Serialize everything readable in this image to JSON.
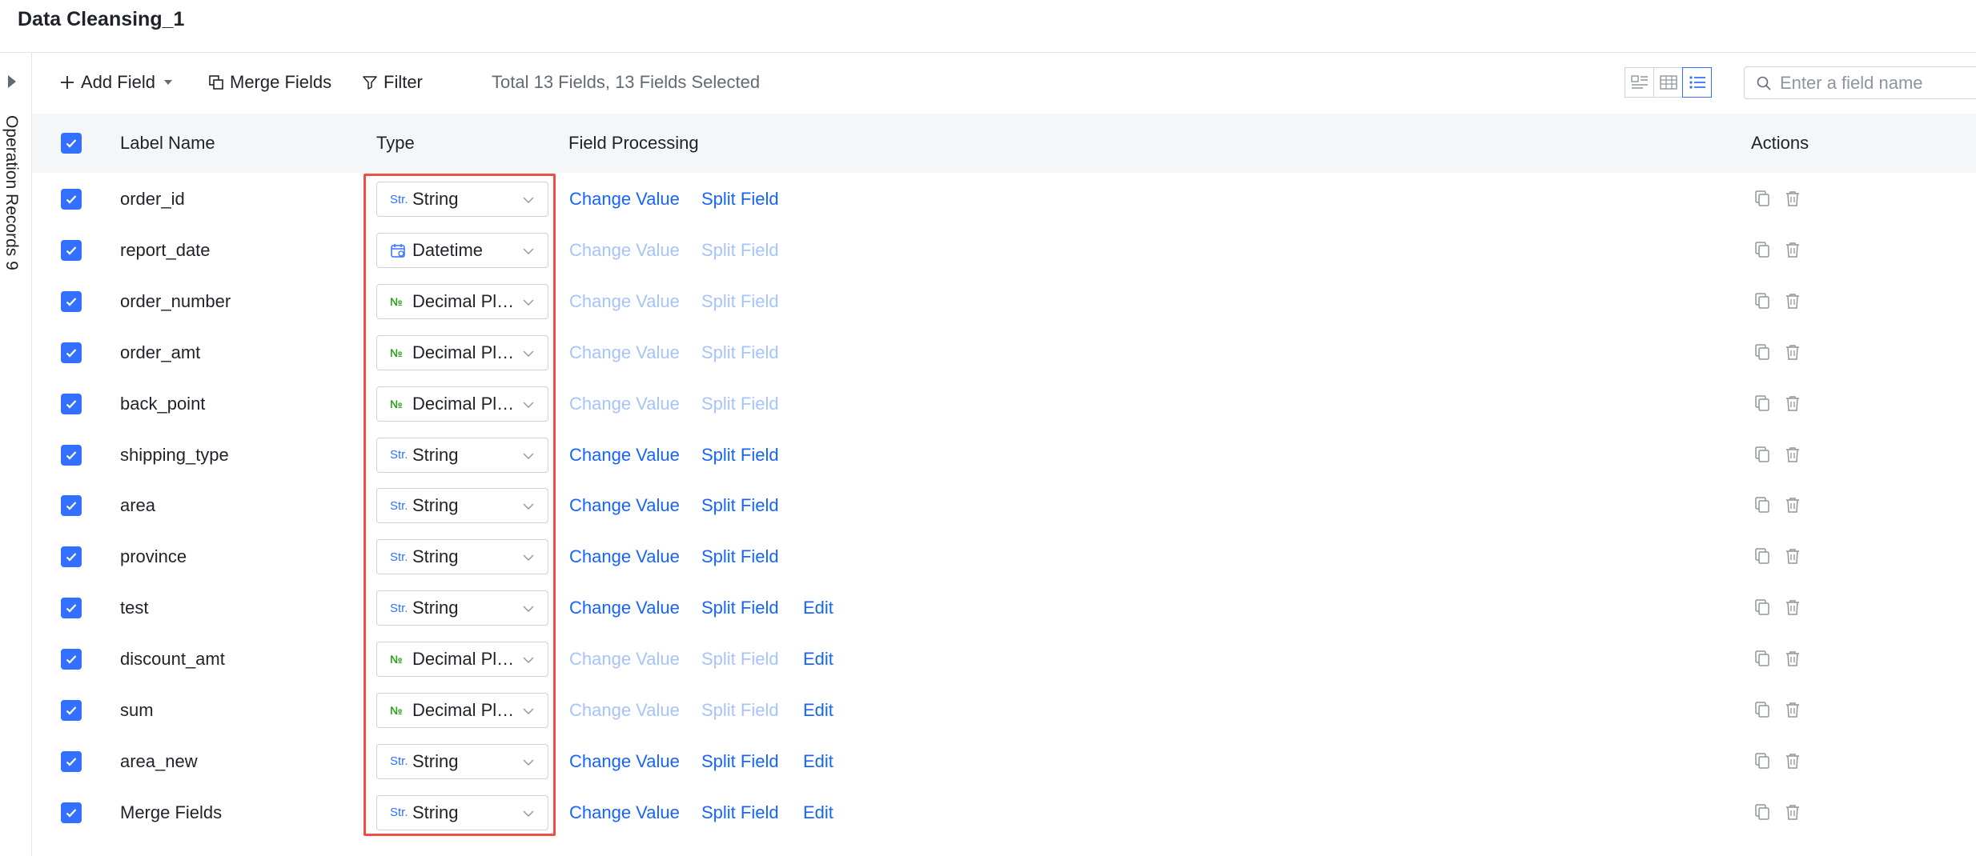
{
  "page": {
    "title": "Data Cleansing_1"
  },
  "side_panel": {
    "label": "Operation Records 9"
  },
  "toolbar": {
    "add_field": "Add Field",
    "merge_fields": "Merge Fields",
    "filter": "Filter",
    "summary": "Total 13 Fields, 13 Fields Selected",
    "active_view": "list"
  },
  "search": {
    "placeholder": "Enter a field name",
    "value": ""
  },
  "table": {
    "headers": {
      "label_name": "Label Name",
      "type": "Type",
      "field_processing": "Field Processing",
      "actions": "Actions"
    },
    "all_selected": true,
    "rows": [
      {
        "label": "order_id",
        "type": "String",
        "type_icon": "Str.",
        "kind": "str",
        "change_value": "Change Value",
        "split_field": "Split Field",
        "processing_enabled": true,
        "edit": ""
      },
      {
        "label": "report_date",
        "type": "Datetime",
        "type_icon": "calendar-icon",
        "kind": "date",
        "change_value": "Change Value",
        "split_field": "Split Field",
        "processing_enabled": false,
        "edit": ""
      },
      {
        "label": "order_number",
        "type": "Decimal Places",
        "type_icon": "№",
        "kind": "num",
        "change_value": "Change Value",
        "split_field": "Split Field",
        "processing_enabled": false,
        "edit": ""
      },
      {
        "label": "order_amt",
        "type": "Decimal Places",
        "type_icon": "№",
        "kind": "num",
        "change_value": "Change Value",
        "split_field": "Split Field",
        "processing_enabled": false,
        "edit": ""
      },
      {
        "label": "back_point",
        "type": "Decimal Places",
        "type_icon": "№",
        "kind": "num",
        "change_value": "Change Value",
        "split_field": "Split Field",
        "processing_enabled": false,
        "edit": ""
      },
      {
        "label": "shipping_type",
        "type": "String",
        "type_icon": "Str.",
        "kind": "str",
        "change_value": "Change Value",
        "split_field": "Split Field",
        "processing_enabled": true,
        "edit": ""
      },
      {
        "label": "area",
        "type": "String",
        "type_icon": "Str.",
        "kind": "str",
        "change_value": "Change Value",
        "split_field": "Split Field",
        "processing_enabled": true,
        "edit": ""
      },
      {
        "label": "province",
        "type": "String",
        "type_icon": "Str.",
        "kind": "str",
        "change_value": "Change Value",
        "split_field": "Split Field",
        "processing_enabled": true,
        "edit": ""
      },
      {
        "label": "test",
        "type": "String",
        "type_icon": "Str.",
        "kind": "str",
        "change_value": "Change Value",
        "split_field": "Split Field",
        "processing_enabled": true,
        "edit": "Edit"
      },
      {
        "label": "discount_amt",
        "type": "Decimal Places",
        "type_icon": "№",
        "kind": "num",
        "change_value": "Change Value",
        "split_field": "Split Field",
        "processing_enabled": false,
        "edit": "Edit"
      },
      {
        "label": "sum",
        "type": "Decimal Places",
        "type_icon": "№",
        "kind": "num",
        "change_value": "Change Value",
        "split_field": "Split Field",
        "processing_enabled": false,
        "edit": "Edit"
      },
      {
        "label": "area_new",
        "type": "String",
        "type_icon": "Str.",
        "kind": "str",
        "change_value": "Change Value",
        "split_field": "Split Field",
        "processing_enabled": true,
        "edit": "Edit"
      },
      {
        "label": "Merge Fields",
        "type": "String",
        "type_icon": "Str.",
        "kind": "str",
        "change_value": "Change Value",
        "split_field": "Split Field",
        "processing_enabled": true,
        "edit": "Edit"
      }
    ]
  },
  "colors": {
    "accent": "#3370ff",
    "link": "#1664ff",
    "link_disabled": "#a6c4fc",
    "highlight": "#f04d45",
    "number_icon": "#2ea121"
  }
}
